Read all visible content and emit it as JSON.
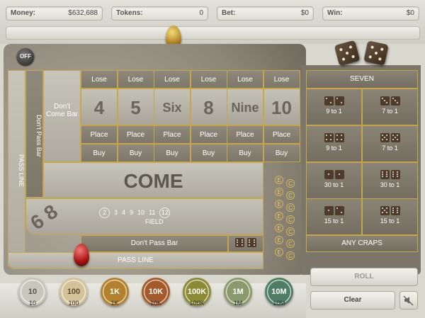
{
  "stats": {
    "money_label": "Money:",
    "money_value": "$632,688",
    "tokens_label": "Tokens:",
    "tokens_value": "0",
    "bet_label": "Bet:",
    "bet_value": "$0",
    "win_label": "Win:",
    "win_value": "$0"
  },
  "table": {
    "off_label": "OFF",
    "pass_line_side": "PASS LINE",
    "dont_pass_side": "Don't Pass Bar",
    "dont_come_bar": "Don't Come Bar",
    "points": [
      {
        "lose": "Lose",
        "label": "4",
        "place": "Place",
        "buy": "Buy"
      },
      {
        "lose": "Lose",
        "label": "5",
        "place": "Place",
        "buy": "Buy"
      },
      {
        "lose": "Lose",
        "label": "Six",
        "place": "Place",
        "buy": "Buy"
      },
      {
        "lose": "Lose",
        "label": "8",
        "place": "Place",
        "buy": "Buy"
      },
      {
        "lose": "Lose",
        "label": "Nine",
        "place": "Place",
        "buy": "Buy"
      },
      {
        "lose": "Lose",
        "label": "10",
        "place": "Place",
        "buy": "Buy"
      }
    ],
    "come": "COME",
    "big_6_8": "6 8",
    "field_label": "FIELD",
    "field_numbers": [
      "2",
      "3",
      "4",
      "9",
      "10",
      "11",
      "12"
    ],
    "dont_pass_bar": "Don't Pass Bar",
    "pass_line": "PASS LINE",
    "ec_letters": [
      "E",
      "C",
      "E",
      "C",
      "E",
      "C",
      "E",
      "C",
      "E",
      "C",
      "E",
      "C",
      "E",
      "C"
    ]
  },
  "props": {
    "seven": "SEVEN",
    "any_craps": "ANY CRAPS",
    "bets": [
      {
        "odds": "9 to 1",
        "dice": [
          2,
          2
        ]
      },
      {
        "odds": "7 to 1",
        "dice": [
          3,
          3
        ]
      },
      {
        "odds": "9 to 1",
        "dice": [
          4,
          4
        ]
      },
      {
        "odds": "7 to 1",
        "dice": [
          5,
          5
        ]
      },
      {
        "odds": "30 to 1",
        "dice": [
          1,
          1
        ]
      },
      {
        "odds": "30 to 1",
        "dice": [
          6,
          6
        ]
      },
      {
        "odds": "15 to 1",
        "dice": [
          1,
          2
        ]
      },
      {
        "odds": "15 to 1",
        "dice": [
          5,
          6
        ]
      }
    ]
  },
  "controls": {
    "roll": "ROLL",
    "clear": "Clear",
    "sound_icon": "sound-muted-icon"
  },
  "chips": [
    {
      "label": "10",
      "face": "10",
      "color": "#c9c6bb",
      "text": "#555"
    },
    {
      "label": "100",
      "face": "100",
      "color": "#d4c39a",
      "text": "#5a4a2a"
    },
    {
      "label": "1K",
      "face": "1K",
      "color": "#b3802e",
      "text": "#fff"
    },
    {
      "label": "10K",
      "face": "10K",
      "color": "#a55a2b",
      "text": "#fff"
    },
    {
      "label": "100K",
      "face": "100K",
      "color": "#8c8a34",
      "text": "#fff"
    },
    {
      "label": "1M",
      "face": "1M",
      "color": "#8a9a6c",
      "text": "#fff"
    },
    {
      "label": "10M",
      "face": "10M",
      "color": "#4e7c64",
      "text": "#fff"
    }
  ]
}
